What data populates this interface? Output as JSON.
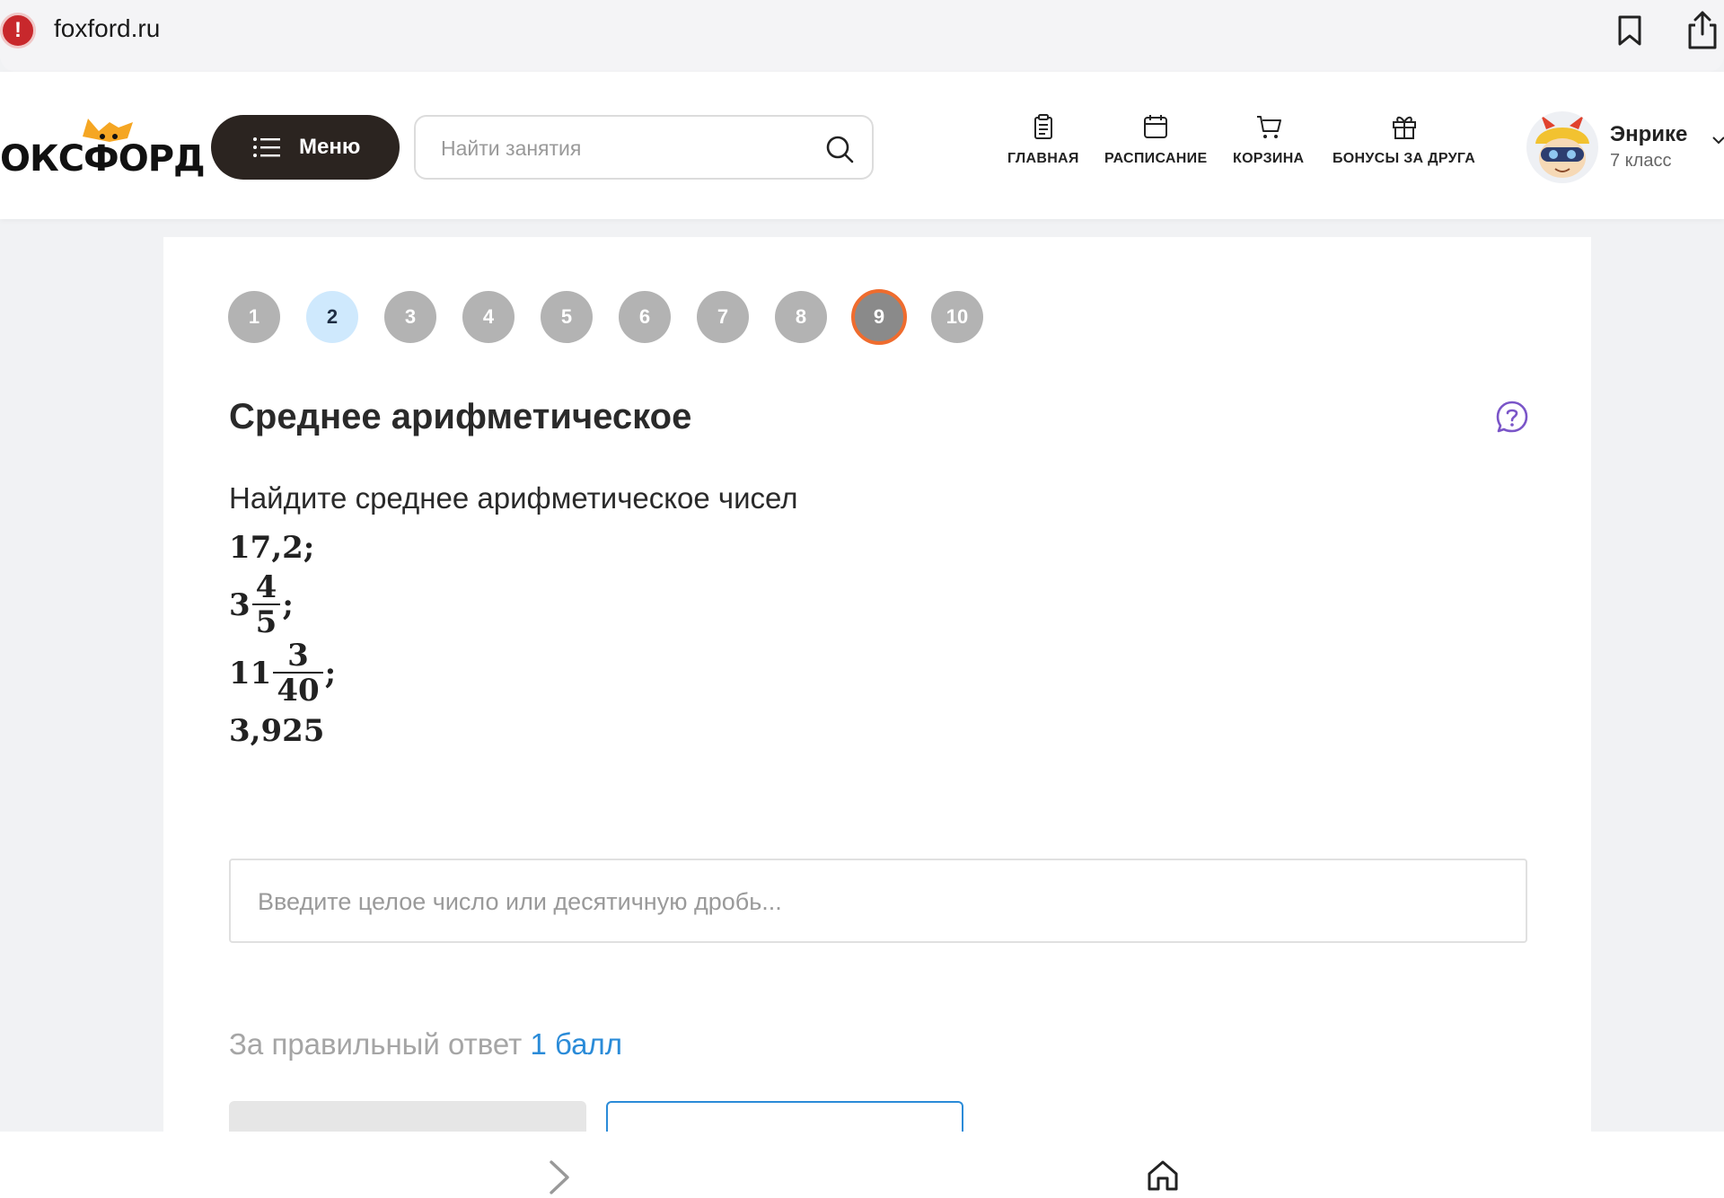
{
  "browser": {
    "url": "foxford.ru",
    "warning_icon": "exclamation-icon",
    "bookmark_icon": "bookmark-icon",
    "share_icon": "share-icon"
  },
  "header": {
    "logo_text": "ОКСФОРД",
    "menu_label": "Меню",
    "search_placeholder": "Найти занятия",
    "nav": [
      {
        "label": "ГЛАВНАЯ",
        "icon": "clipboard-icon"
      },
      {
        "label": "РАСПИСАНИЕ",
        "icon": "calendar-icon"
      },
      {
        "label": "КОРЗИНА",
        "icon": "cart-icon"
      },
      {
        "label": "БОНУСЫ ЗА ДРУГА",
        "icon": "gift-icon"
      }
    ],
    "user": {
      "name": "Энрике",
      "grade": "7 класс"
    }
  },
  "task": {
    "steps": [
      "1",
      "2",
      "3",
      "4",
      "5",
      "6",
      "7",
      "8",
      "9",
      "10"
    ],
    "visited_step": "2",
    "current_step": "9",
    "title": "Среднее арифметическое",
    "text": "Найдите среднее арифметическое чисел",
    "numbers": {
      "n1": "17,2;",
      "n2_whole": "3",
      "n2_num": "4",
      "n2_den": "5",
      "n2_sep": ";",
      "n3_whole": "11",
      "n3_num": "3",
      "n3_den": "40",
      "n3_sep": ";",
      "n4": "3,925"
    },
    "answer_placeholder": "Введите целое число или десятичную дробь...",
    "score_prefix": "За правильный ответ",
    "score_value": "1 балл"
  },
  "colors": {
    "menu_bg": "#2b2420",
    "current_step_ring": "#ef6c2e",
    "visited_step_bg": "#cfe9fd",
    "accent_blue": "#2a8bd8",
    "help_purple": "#7a55c8"
  }
}
